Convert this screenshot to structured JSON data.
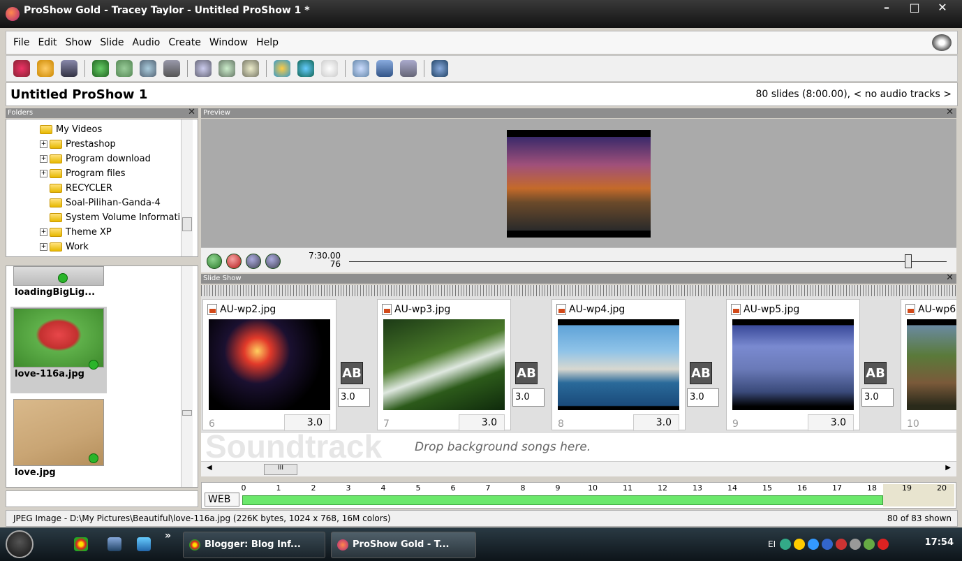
{
  "window": {
    "title": "ProShow Gold - Tracey Taylor - Untitled ProShow 1 *",
    "minimize": "–",
    "maximize": "□",
    "close": "✕"
  },
  "menu": [
    "File",
    "Edit",
    "Show",
    "Slide",
    "Audio",
    "Create",
    "Window",
    "Help"
  ],
  "show": {
    "title": "Untitled ProShow 1",
    "info": "80 slides (8:00.00), < no audio tracks >"
  },
  "panels": {
    "folders": "Folders",
    "preview": "Preview",
    "slideshow": "Slide Show",
    "close": "✕"
  },
  "folders": [
    {
      "label": "My Videos",
      "expand": ""
    },
    {
      "label": "Prestashop",
      "expand": "+"
    },
    {
      "label": "Program download",
      "expand": "+"
    },
    {
      "label": "Program files",
      "expand": "+"
    },
    {
      "label": "RECYCLER",
      "expand": ""
    },
    {
      "label": "Soal-Pilihan-Ganda-4",
      "expand": ""
    },
    {
      "label": "System Volume Informati",
      "expand": ""
    },
    {
      "label": "Theme XP",
      "expand": "+"
    },
    {
      "label": "Work",
      "expand": "+"
    }
  ],
  "thumbnails": [
    {
      "label": "loadingBigLig..."
    },
    {
      "label": "love-116a.jpg"
    },
    {
      "label": "love.jpg"
    }
  ],
  "transport": {
    "time": "7:30.00",
    "frame": "76"
  },
  "slides": [
    {
      "name": "AU-wp2.jpg",
      "num": "6",
      "dur": "3.0",
      "trans": "3.0"
    },
    {
      "name": "AU-wp3.jpg",
      "num": "7",
      "dur": "3.0",
      "trans": "3.0"
    },
    {
      "name": "AU-wp4.jpg",
      "num": "8",
      "dur": "3.0",
      "trans": "3.0"
    },
    {
      "name": "AU-wp5.jpg",
      "num": "9",
      "dur": "3.0",
      "trans": "3.0"
    },
    {
      "name": "AU-wp6",
      "num": "10",
      "dur": "",
      "trans": ""
    }
  ],
  "transition_label": "AB",
  "soundtrack": {
    "big": "Soundtrack",
    "drop": "Drop background songs here."
  },
  "scroll": {
    "left": "◀",
    "right": "▶",
    "thumb": "III"
  },
  "timeline": {
    "label": "WEB",
    "ticks": [
      "0",
      "1",
      "2",
      "3",
      "4",
      "5",
      "6",
      "7",
      "8",
      "9",
      "10",
      "11",
      "12",
      "13",
      "14",
      "15",
      "16",
      "17",
      "18",
      "19",
      "20"
    ]
  },
  "status": {
    "left": "JPEG Image - D:\\My Pictures\\Beautiful\\love-116a.jpg  (226K bytes, 1024 x 768, 16M colors)",
    "right": "80 of 83 shown"
  },
  "taskbar": {
    "more": "»",
    "task1": "Blogger: Blog Inf...",
    "task2": "ProShow Gold - T...",
    "tray_text": "EI",
    "clock": "17:54"
  }
}
